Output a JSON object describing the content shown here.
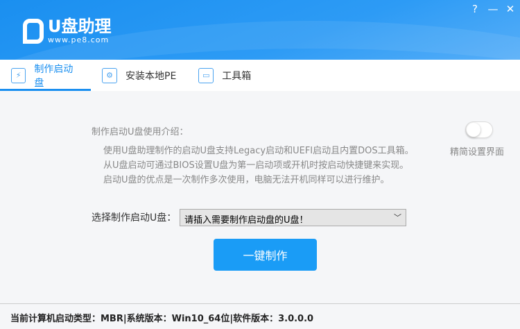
{
  "header": {
    "logo_title": "U盘助理",
    "logo_url": "www.pe8.com",
    "help_icon": "?",
    "minimize_icon": "—",
    "close_icon": "✕"
  },
  "tabs": [
    {
      "label": "制作启动盘",
      "icon": "usb-icon"
    },
    {
      "label": "安装本地PE",
      "icon": "folder-gear-icon"
    },
    {
      "label": "工具箱",
      "icon": "toolbox-icon"
    }
  ],
  "main": {
    "intro_label": "制作启动U盘使用介绍：",
    "intro_lines": [
      "使用U盘助理制作的启动U盘支持Legacy启动和UEFI启动且内置DOS工具箱。",
      "从U盘启动可通过BIOS设置U盘为第一启动项或开机时按启动快捷键来实现。",
      "启动U盘的优点是一次制作多次使用，电脑无法开机同样可以进行维护。"
    ],
    "toggle_label": "精简设置界面",
    "toggle_on": false,
    "select_label": "选择制作启动U盘：",
    "select_value": "请插入需要制作启动盘的U盘！",
    "make_button": "一键制作"
  },
  "status": "当前计算机启动类型：MBR|系统版本：Win10_64位|软件版本：3.0.0.0"
}
